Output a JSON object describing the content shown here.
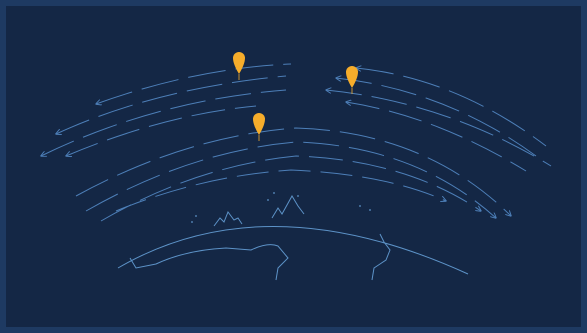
{
  "colors": {
    "background": "#142745",
    "frame_border": "#1e3a62",
    "wind_arrow": "#4d7fb8",
    "earth_outline": "#5d93c8",
    "balloon": "#f6ad2b"
  },
  "icons": {
    "balloon": "balloon-marker-icon",
    "arrow": "wind-arrow-icon"
  },
  "wind_layers": [
    {
      "name": "upper-layer",
      "direction": "westward"
    },
    {
      "name": "lower-layer",
      "direction": "eastward"
    }
  ],
  "balloon_count": 3
}
